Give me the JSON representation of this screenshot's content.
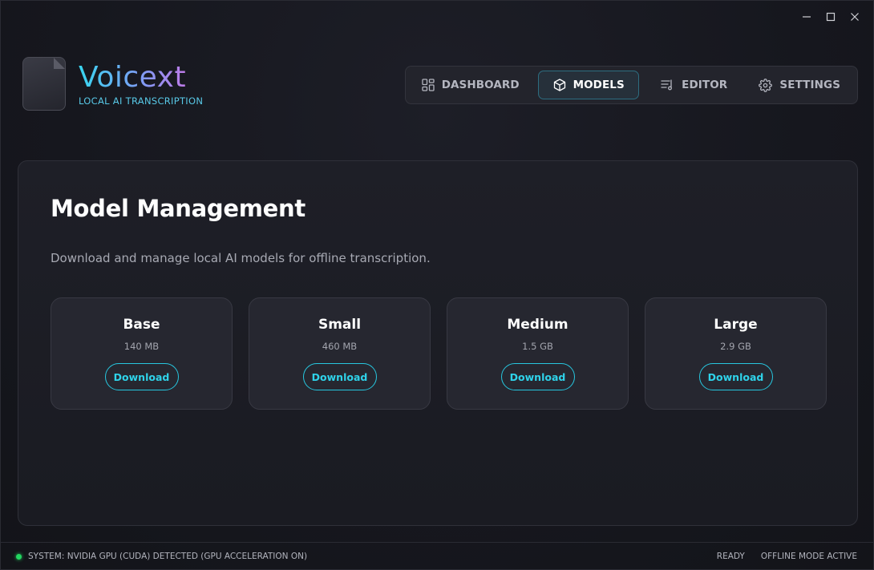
{
  "window": {
    "controls": [
      {
        "name": "minimize-icon"
      },
      {
        "name": "maximize-icon"
      },
      {
        "name": "close-icon"
      }
    ]
  },
  "brand": {
    "title": "Voicext",
    "subtitle": "LOCAL AI TRANSCRIPTION",
    "icon": "waveform-file-icon",
    "gradient": [
      "#38d6f0",
      "#d66ee3"
    ]
  },
  "nav": {
    "items": [
      {
        "label": "DASHBOARD",
        "icon": "dashboard-icon",
        "active": false
      },
      {
        "label": "MODELS",
        "icon": "cube-icon",
        "active": true
      },
      {
        "label": "EDITOR",
        "icon": "editor-icon",
        "active": false
      },
      {
        "label": "SETTINGS",
        "icon": "gear-icon",
        "active": false
      }
    ]
  },
  "main": {
    "title": "Model Management",
    "description": "Download and manage local AI models for offline transcription.",
    "models": [
      {
        "name": "Base",
        "size": "140 MB",
        "action": "Download"
      },
      {
        "name": "Small",
        "size": "460 MB",
        "action": "Download"
      },
      {
        "name": "Medium",
        "size": "1.5 GB",
        "action": "Download"
      },
      {
        "name": "Large",
        "size": "2.9 GB",
        "action": "Download"
      }
    ]
  },
  "status": {
    "system": "SYSTEM: NVIDIA GPU (CUDA) DETECTED (GPU ACCELERATION ON)",
    "state": "READY",
    "mode": "OFFLINE MODE ACTIVE",
    "indicator_color": "#22d660"
  },
  "colors": {
    "accent": "#27c7df",
    "background": "#16171e"
  }
}
